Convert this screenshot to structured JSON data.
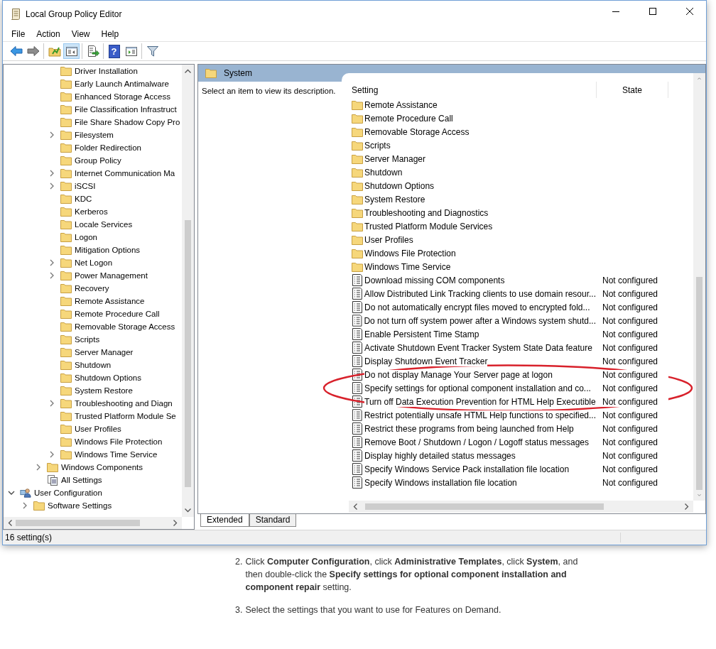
{
  "window": {
    "title": "Local Group Policy Editor"
  },
  "menu": [
    "File",
    "Action",
    "View",
    "Help"
  ],
  "toolbar": [
    {
      "buttons": [
        {
          "kind": "back",
          "pressed": false
        },
        {
          "kind": "forward",
          "pressed": false
        }
      ]
    },
    {
      "buttons": [
        {
          "kind": "up",
          "pressed": false
        },
        {
          "kind": "tree",
          "pressed": true
        }
      ]
    },
    {
      "buttons": [
        {
          "kind": "export",
          "pressed": false
        }
      ]
    },
    {
      "buttons": [
        {
          "kind": "help",
          "glyph": "?",
          "pressed": false
        },
        {
          "kind": "panel",
          "pressed": false
        }
      ]
    },
    {
      "buttons": [
        {
          "kind": "filter",
          "pressed": false
        }
      ]
    }
  ],
  "tree": [
    {
      "children": [
        {
          "children": [
            {
              "children": [
                {
                  "label": "Driver Installation",
                  "kind": "folder",
                  "expandable": false
                },
                {
                  "label": "Early Launch Antimalware",
                  "kind": "folder",
                  "expandable": false
                },
                {
                  "label": "Enhanced Storage Access",
                  "kind": "folder",
                  "expandable": false
                },
                {
                  "label": "File Classification Infrastruct",
                  "kind": "folder",
                  "expandable": false
                },
                {
                  "label": "File Share Shadow Copy Pro",
                  "kind": "folder",
                  "expandable": false
                },
                {
                  "label": "Filesystem",
                  "kind": "folder",
                  "expandable": true,
                  "expanded": false
                },
                {
                  "label": "Folder Redirection",
                  "kind": "folder",
                  "expandable": false
                },
                {
                  "label": "Group Policy",
                  "kind": "folder",
                  "expandable": false
                },
                {
                  "label": "Internet Communication Ma",
                  "kind": "folder",
                  "expandable": true,
                  "expanded": false
                },
                {
                  "label": "iSCSI",
                  "kind": "folder",
                  "expandable": true,
                  "expanded": false
                },
                {
                  "label": "KDC",
                  "kind": "folder",
                  "expandable": false
                },
                {
                  "label": "Kerberos",
                  "kind": "folder",
                  "expandable": false
                },
                {
                  "label": "Locale Services",
                  "kind": "folder",
                  "expandable": false
                },
                {
                  "label": "Logon",
                  "kind": "folder",
                  "expandable": false
                },
                {
                  "label": "Mitigation Options",
                  "kind": "folder",
                  "expandable": false
                },
                {
                  "label": "Net Logon",
                  "kind": "folder",
                  "expandable": true,
                  "expanded": false
                },
                {
                  "label": "Power Management",
                  "kind": "folder",
                  "expandable": true,
                  "expanded": false
                },
                {
                  "label": "Recovery",
                  "kind": "folder",
                  "expandable": false
                },
                {
                  "label": "Remote Assistance",
                  "kind": "folder",
                  "expandable": false
                },
                {
                  "label": "Remote Procedure Call",
                  "kind": "folder",
                  "expandable": false
                },
                {
                  "label": "Removable Storage Access",
                  "kind": "folder",
                  "expandable": false
                },
                {
                  "label": "Scripts",
                  "kind": "folder",
                  "expandable": false
                },
                {
                  "label": "Server Manager",
                  "kind": "folder",
                  "expandable": false
                },
                {
                  "label": "Shutdown",
                  "kind": "folder",
                  "expandable": false
                },
                {
                  "label": "Shutdown Options",
                  "kind": "folder",
                  "expandable": false
                },
                {
                  "label": "System Restore",
                  "kind": "folder",
                  "expandable": false
                },
                {
                  "label": "Troubleshooting and Diagn",
                  "kind": "folder",
                  "expandable": true,
                  "expanded": false
                },
                {
                  "label": "Trusted Platform Module Se",
                  "kind": "folder",
                  "expandable": false
                },
                {
                  "label": "User Profiles",
                  "kind": "folder",
                  "expandable": false
                },
                {
                  "label": "Windows File Protection",
                  "kind": "folder",
                  "expandable": false
                },
                {
                  "label": "Windows Time Service",
                  "kind": "folder",
                  "expandable": true,
                  "expanded": false
                }
              ]
            },
            {
              "label": "Windows Components",
              "kind": "folder",
              "expandable": true,
              "expanded": false
            },
            {
              "label": "All Settings",
              "kind": "settings",
              "expandable": false
            }
          ]
        }
      ]
    },
    {
      "label": "User Configuration",
      "kind": "user",
      "expandable": true,
      "expanded": true,
      "children": [
        {
          "label": "Software Settings",
          "kind": "folder",
          "expandable": true,
          "expanded": false
        }
      ]
    }
  ],
  "details": {
    "header": "System",
    "description": "Select an item to view its description.",
    "columns": [
      "Setting",
      "State"
    ],
    "rows": [
      {
        "kind": "folder",
        "name": "Remote Assistance",
        "circled": false
      },
      {
        "kind": "folder",
        "name": "Remote Procedure Call",
        "circled": false
      },
      {
        "kind": "folder",
        "name": "Removable Storage Access",
        "circled": false
      },
      {
        "kind": "folder",
        "name": "Scripts",
        "circled": false
      },
      {
        "kind": "folder",
        "name": "Server Manager",
        "circled": false
      },
      {
        "kind": "folder",
        "name": "Shutdown",
        "circled": false
      },
      {
        "kind": "folder",
        "name": "Shutdown Options",
        "circled": false
      },
      {
        "kind": "folder",
        "name": "System Restore",
        "circled": false
      },
      {
        "kind": "folder",
        "name": "Troubleshooting and Diagnostics",
        "circled": false
      },
      {
        "kind": "folder",
        "name": "Trusted Platform Module Services",
        "circled": false
      },
      {
        "kind": "folder",
        "name": "User Profiles",
        "circled": false
      },
      {
        "kind": "folder",
        "name": "Windows File Protection",
        "circled": false
      },
      {
        "kind": "folder",
        "name": "Windows Time Service",
        "circled": false
      },
      {
        "kind": "setting",
        "name": "Download missing COM components",
        "state": "Not configured",
        "circled": false
      },
      {
        "kind": "setting",
        "name": "Allow Distributed Link Tracking clients to use domain resour...",
        "state": "Not configured",
        "circled": false
      },
      {
        "kind": "setting",
        "name": "Do not automatically encrypt files moved to encrypted fold...",
        "state": "Not configured",
        "circled": false
      },
      {
        "kind": "setting",
        "name": "Do not turn off system power after a Windows system shutd...",
        "state": "Not configured",
        "circled": false
      },
      {
        "kind": "setting",
        "name": "Enable Persistent Time Stamp",
        "state": "Not configured",
        "circled": false
      },
      {
        "kind": "setting",
        "name": "Activate Shutdown Event Tracker System State Data feature",
        "state": "Not configured",
        "circled": false
      },
      {
        "kind": "setting",
        "name": "Display Shutdown Event Tracker",
        "state": "Not configured",
        "circled": false
      },
      {
        "kind": "setting",
        "name": "Do not display Manage Your Server page at logon",
        "state": "Not configured",
        "circled": true
      },
      {
        "kind": "setting",
        "name": "Specify settings for optional component installation and co...",
        "state": "Not configured",
        "circled": true
      },
      {
        "kind": "setting",
        "name": "Turn off Data Execution Prevention for HTML Help Executible",
        "state": "Not configured",
        "circled": true
      },
      {
        "kind": "setting",
        "name": "Restrict potentially unsafe HTML Help functions to specified...",
        "state": "Not configured",
        "circled": false
      },
      {
        "kind": "setting",
        "name": "Restrict these programs from being launched from Help",
        "state": "Not configured",
        "circled": false
      },
      {
        "kind": "setting",
        "name": "Remove Boot / Shutdown / Logon / Logoff status messages",
        "state": "Not configured",
        "circled": false
      },
      {
        "kind": "setting",
        "name": "Display highly detailed status messages",
        "state": "Not configured",
        "circled": false
      },
      {
        "kind": "setting",
        "name": "Specify Windows Service Pack installation file location",
        "state": "Not configured",
        "circled": false
      },
      {
        "kind": "setting",
        "name": "Specify Windows installation file location",
        "state": "Not configured",
        "circled": false
      }
    ]
  },
  "tabs": [
    {
      "label": "Extended",
      "selected": true
    },
    {
      "label": "Standard",
      "selected": false
    }
  ],
  "status_bar": "16 setting(s)",
  "instructions": [
    {
      "number": "2.",
      "text": "Click **Computer Configuration**, click **Administrative Templates**, click **System**, and then double-click the **Specify settings for optional component installation and component repair** setting."
    },
    {
      "number": "3.",
      "text": "Select the settings that you want to use for Features on Demand."
    }
  ]
}
